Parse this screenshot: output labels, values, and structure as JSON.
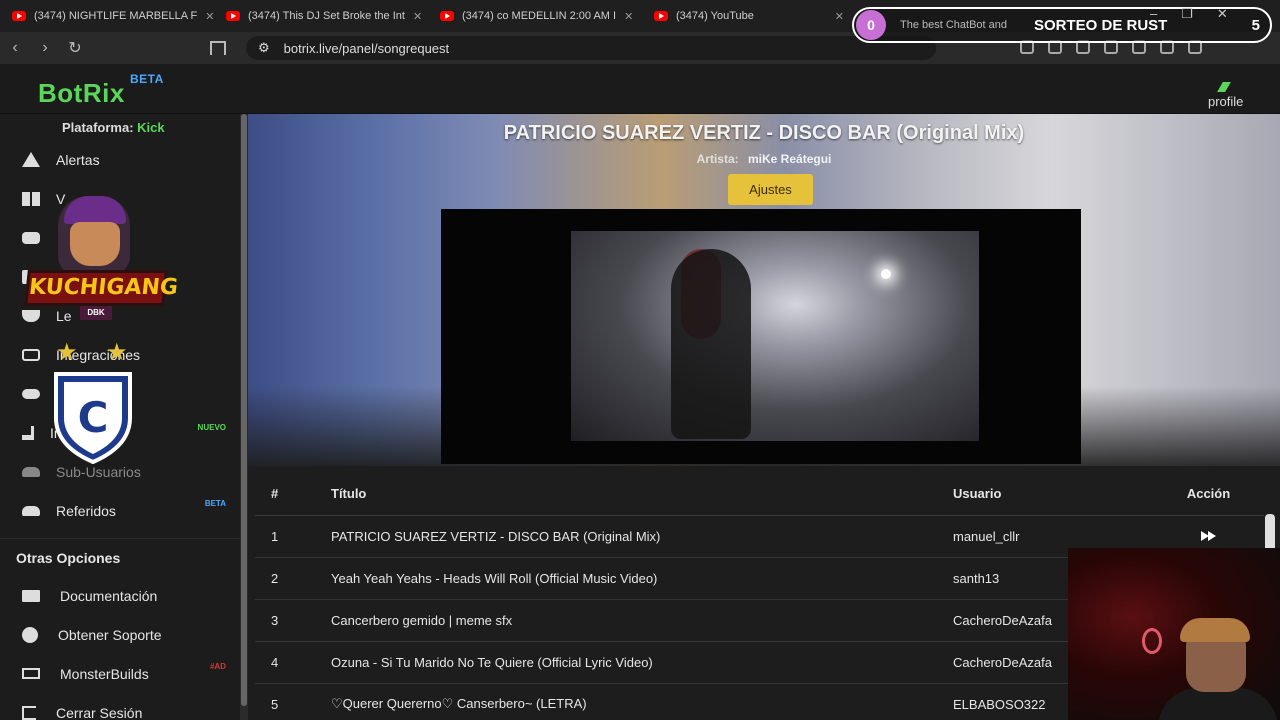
{
  "browser": {
    "tabs": [
      {
        "label": "(3474) NIGHTLIFE MARBELLA F"
      },
      {
        "label": "(3474) This DJ Set Broke the Int"
      },
      {
        "label": "(3474) co MEDELLIN 2:00 AM I"
      },
      {
        "label": "(3474) YouTube"
      }
    ],
    "url": "botrix.live/panel/songrequest",
    "bot_tab_label": "The best ChatBot and"
  },
  "raffle": {
    "count": "0",
    "title": "SORTEO DE RUST",
    "number": "5"
  },
  "header": {
    "logo": "BotRix",
    "logo_badge": "BETA",
    "profile_label": "profile"
  },
  "sidebar": {
    "platform_label": "Plataforma:",
    "platform_value": "Kick",
    "items": [
      {
        "label": "Alertas",
        "icon": "alert-icon"
      },
      {
        "label": "V",
        "icon": "grid-icon"
      },
      {
        "label": "",
        "icon": "robot-icon"
      },
      {
        "label": "",
        "icon": "book-icon"
      },
      {
        "label": "Le",
        "icon": "trophy-icon"
      },
      {
        "label": "Integraciones",
        "icon": "plug-icon"
      },
      {
        "label": "",
        "icon": "gamepad-icon"
      },
      {
        "label": "In",
        "icon": "music-icon",
        "badge": "NUEVO"
      },
      {
        "label": "Sub-Usuarios",
        "icon": "users-icon"
      },
      {
        "label": "Referidos",
        "icon": "referrals-icon",
        "badge": "BETA"
      }
    ],
    "other_title": "Otras Opciones",
    "other_items": [
      {
        "label": "Documentación",
        "icon": "document-icon"
      },
      {
        "label": "Obtener Soporte",
        "icon": "help-icon"
      },
      {
        "label": "MonsterBuilds",
        "icon": "laptop-icon",
        "badge": "#AD"
      },
      {
        "label": "Cerrar Sesión",
        "icon": "logout-icon"
      }
    ]
  },
  "overlay": {
    "brand": "KUCHIGANG",
    "brand_sub": "DBK",
    "crest_letter": "C"
  },
  "now_playing": {
    "title": "PATRICIO SUAREZ VERTIZ - DISCO BAR (Original Mix)",
    "artist_label": "Artista:",
    "artist": "miKe Reátegui",
    "settings_button": "Ajustes"
  },
  "queue": {
    "columns": [
      "#",
      "Título",
      "Usuario",
      "Acción"
    ],
    "rows": [
      {
        "num": "1",
        "title": "PATRICIO SUAREZ VERTIZ - DISCO BAR (Original Mix)",
        "user": "manuel_cllr"
      },
      {
        "num": "2",
        "title": "Yeah Yeah Yeahs - Heads Will Roll (Official Music Video)",
        "user": "santh13"
      },
      {
        "num": "3",
        "title": "Cancerbero gemido | meme sfx",
        "user": "CacheroDeAzafa"
      },
      {
        "num": "4",
        "title": "Ozuna - Si Tu Marido No Te Quiere (Official Lyric Video)",
        "user": "CacheroDeAzafa"
      },
      {
        "num": "5",
        "title": "♡Querer Quererno♡ Canserbero~ (LETRA)",
        "user": "ELBABOSO322"
      }
    ]
  },
  "colors": {
    "brand_green": "#5bd65b",
    "beta_blue": "#4aa8ff",
    "button_yellow": "#e6c23a"
  }
}
